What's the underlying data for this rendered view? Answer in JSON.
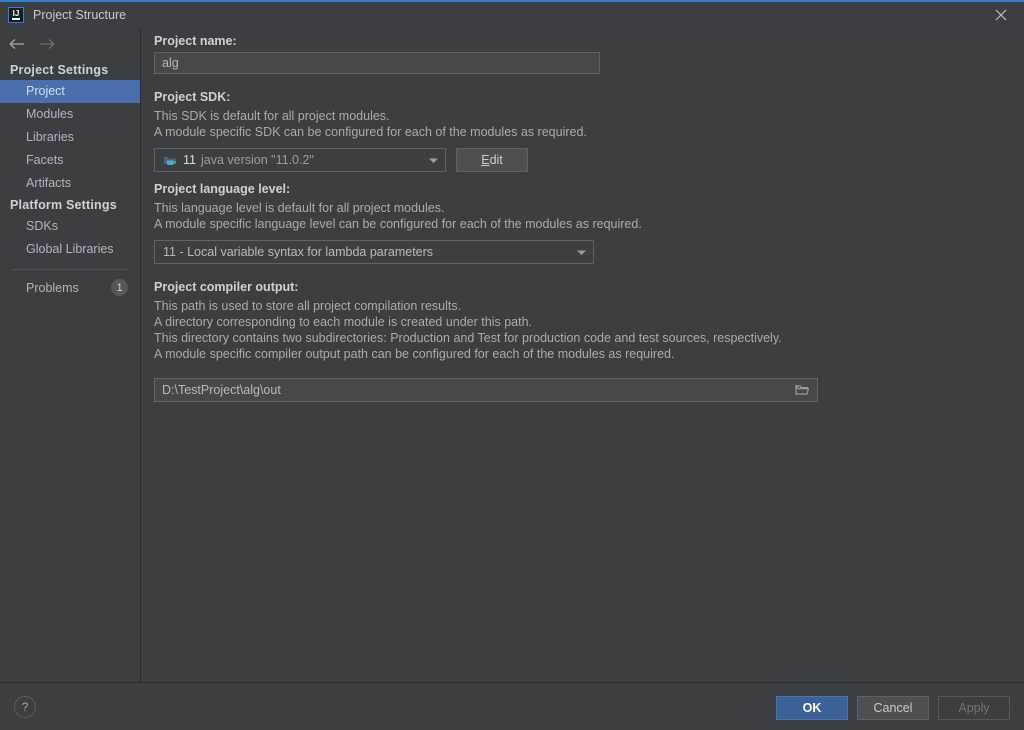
{
  "window": {
    "title": "Project Structure",
    "app_icon": "intellij-idea-icon",
    "close_icon": "close-icon",
    "accent_color": "#2f7fd2"
  },
  "nav": {
    "back_icon": "arrow-left-icon",
    "forward_icon": "arrow-right-icon"
  },
  "sidebar": {
    "groups": [
      {
        "header": "Project Settings",
        "items": [
          {
            "label": "Project",
            "selected": true
          },
          {
            "label": "Modules",
            "selected": false
          },
          {
            "label": "Libraries",
            "selected": false
          },
          {
            "label": "Facets",
            "selected": false
          },
          {
            "label": "Artifacts",
            "selected": false
          }
        ]
      },
      {
        "header": "Platform Settings",
        "items": [
          {
            "label": "SDKs",
            "selected": false
          },
          {
            "label": "Global Libraries",
            "selected": false
          }
        ]
      }
    ],
    "problems": {
      "label": "Problems",
      "count": "1"
    },
    "selection_color": "#4b6eaf"
  },
  "main": {
    "project_name": {
      "title": "Project name:",
      "value": "alg",
      "placeholder": ""
    },
    "project_sdk": {
      "title": "Project SDK:",
      "description_lines": [
        "This SDK is default for all project modules.",
        "A module specific SDK can be configured for each of the modules as required."
      ],
      "sdk_icon": "java-sdk-icon",
      "version": "11",
      "version_detail": "java version \"11.0.2\"",
      "dropdown_icon": "chevron-down-icon",
      "edit_button": "Edit",
      "edit_mnemonic": "E",
      "edit_rest": "dit"
    },
    "language_level": {
      "title": "Project language level:",
      "description_lines": [
        "This language level is default for all project modules.",
        "A module specific language level can be configured for each of the modules as required."
      ],
      "value": "11 - Local variable syntax for lambda parameters",
      "dropdown_icon": "chevron-down-icon"
    },
    "compiler_output": {
      "title": "Project compiler output:",
      "description_lines": [
        "This path is used to store all project compilation results.",
        "A directory corresponding to each module is created under this path.",
        "This directory contains two subdirectories: Production and Test for production code and test sources, respectively.",
        "A module specific compiler output path can be configured for each of the modules as required."
      ],
      "path": "D:\\TestProject\\alg\\out",
      "browse_icon": "folder-icon"
    }
  },
  "footer": {
    "help_label": "?",
    "ok_label": "OK",
    "cancel_label": "Cancel",
    "apply_label": "Apply",
    "ok_color": "#3c6199"
  }
}
